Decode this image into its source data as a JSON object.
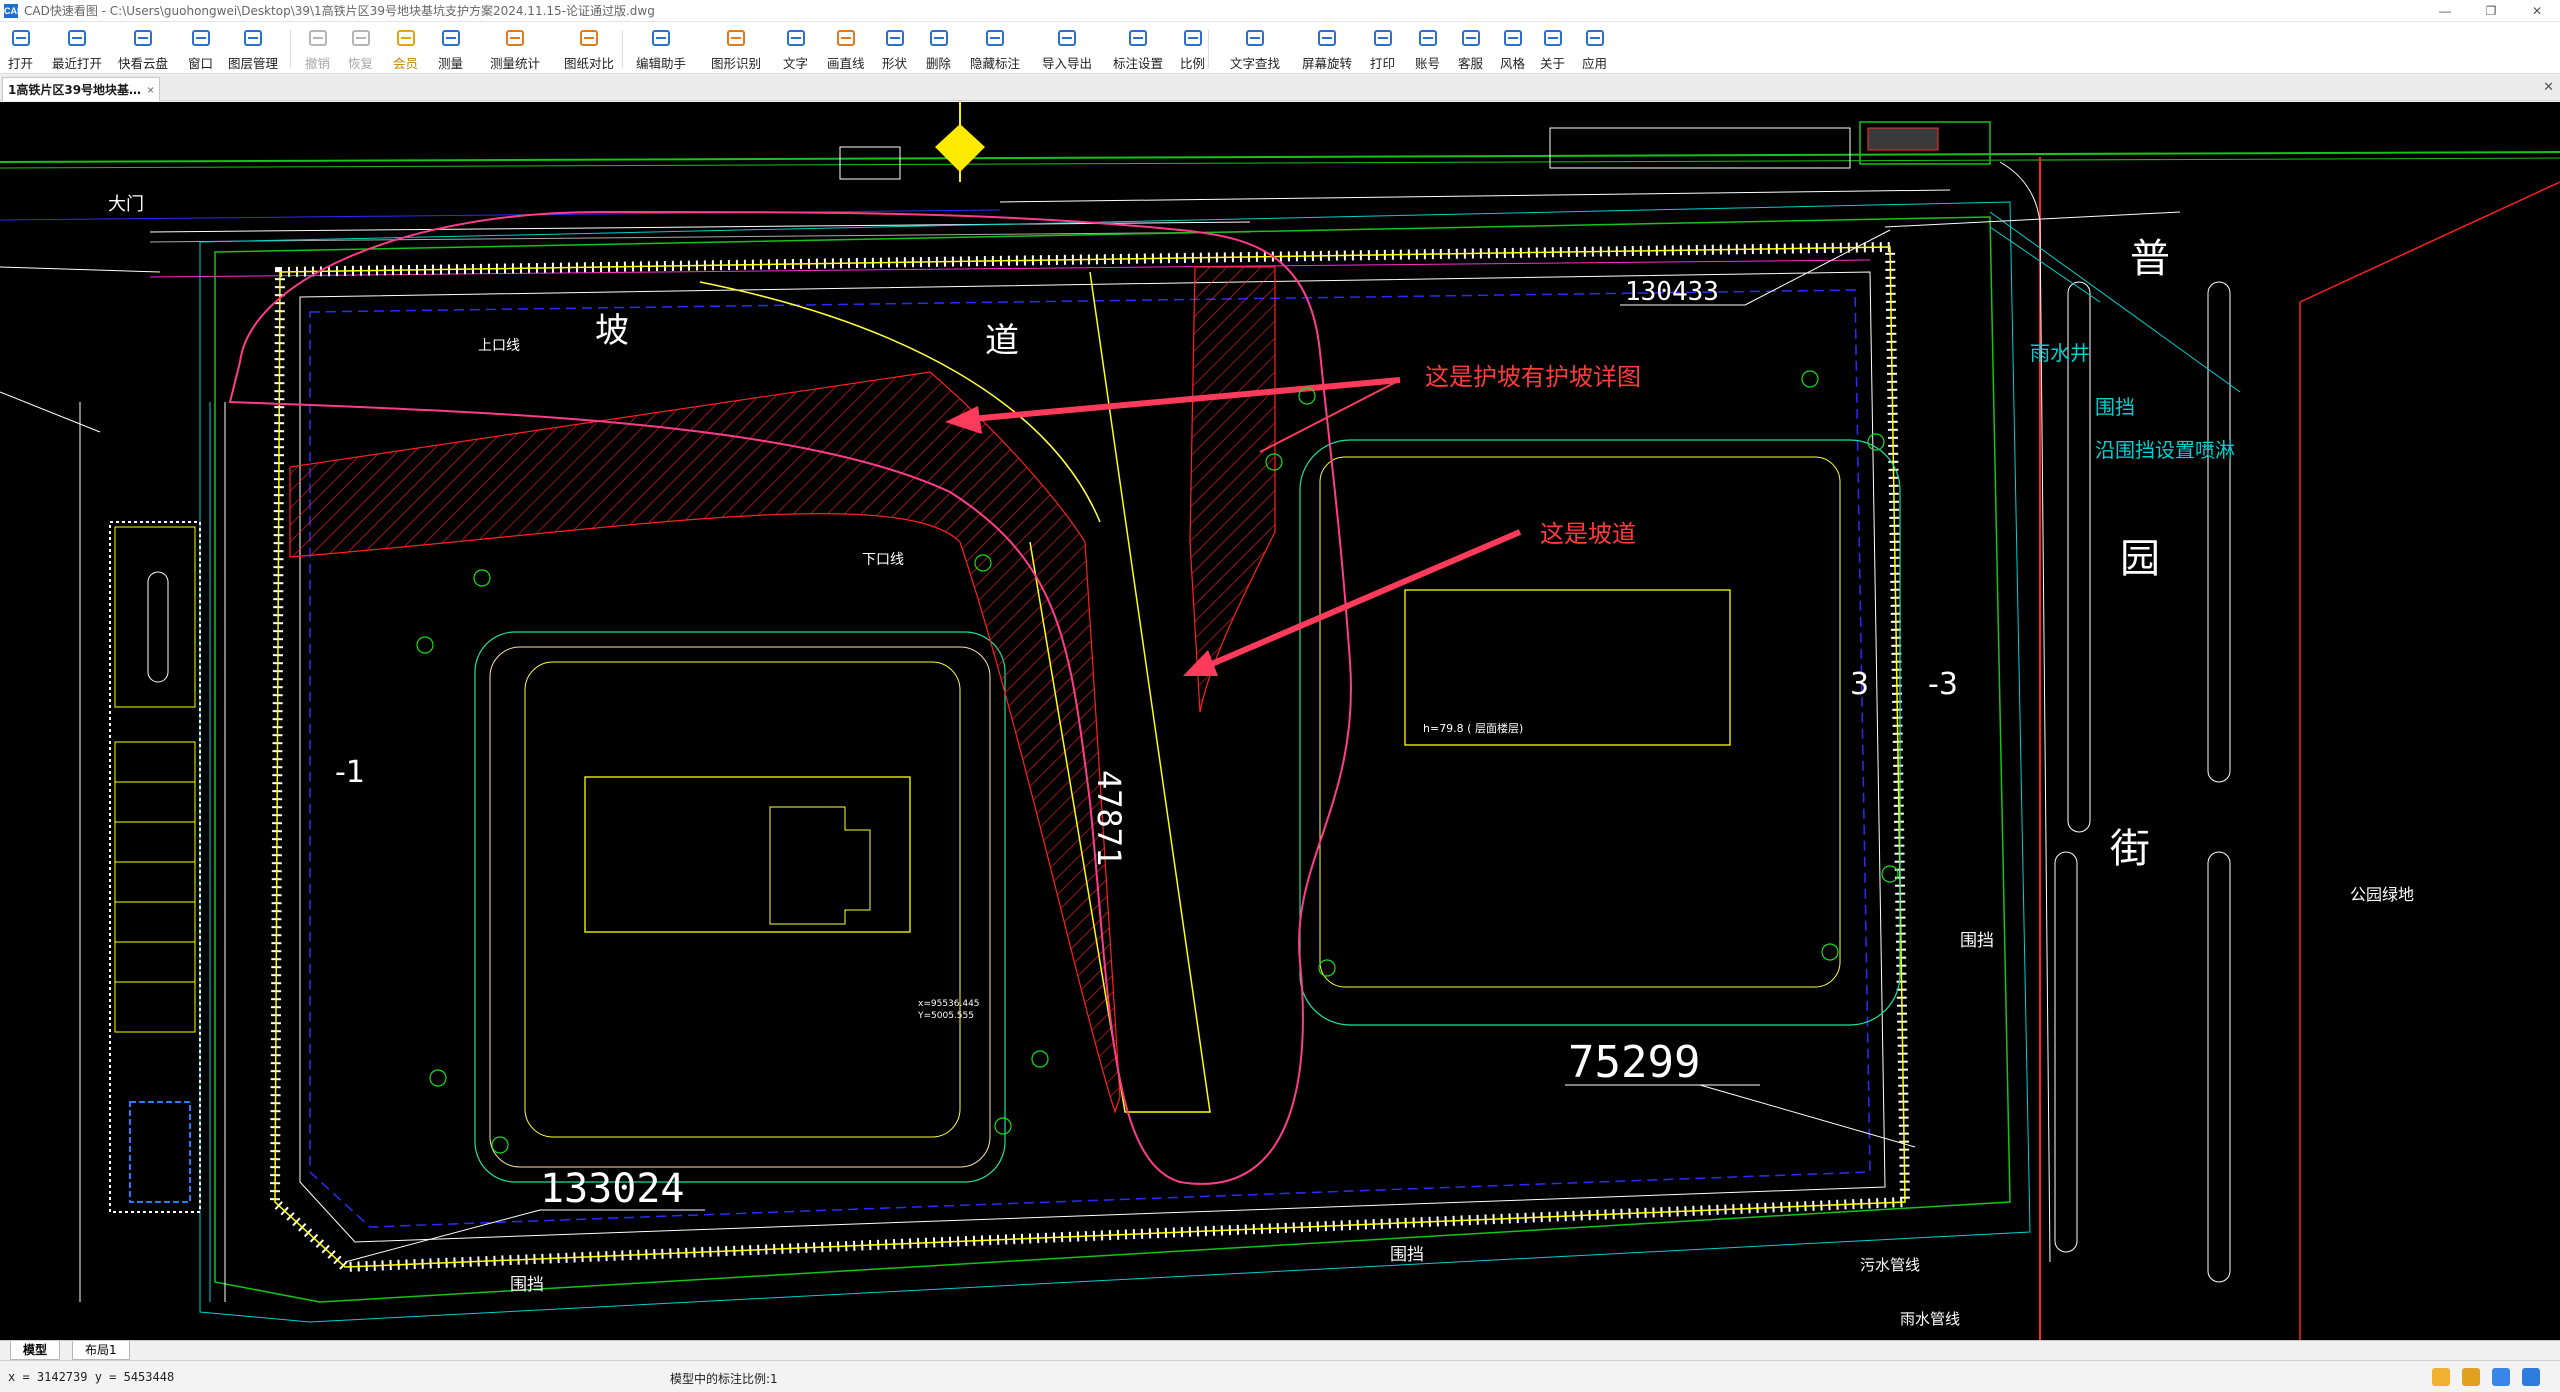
{
  "window": {
    "title": "CAD快速看图 - C:\\Users\\guohongwei\\Desktop\\39\\1高铁片区39号地块基坑支护方案2024.11.15-论证通过版.dwg",
    "app_icon": "CAD"
  },
  "toolbar": {
    "buttons": [
      {
        "label": "打开",
        "icon": "folder-open-icon",
        "color": "#2b6fcf"
      },
      {
        "label": "最近打开",
        "icon": "clock-icon",
        "color": "#2b6fcf"
      },
      {
        "label": "快看云盘",
        "icon": "cloud-icon",
        "color": "#2b6fcf"
      },
      {
        "label": "窗口",
        "icon": "window-icon",
        "color": "#2b6fcf"
      },
      {
        "label": "图层管理",
        "icon": "layers-icon",
        "color": "#2b6fcf"
      },
      {
        "label": "撤销",
        "icon": "undo-icon",
        "color": "#b5b5b5",
        "disabled": true
      },
      {
        "label": "恢复",
        "icon": "redo-icon",
        "color": "#b5b5b5",
        "disabled": true
      },
      {
        "label": "会员",
        "icon": "vip-icon",
        "color": "#e8a400",
        "vip": true
      },
      {
        "label": "测量",
        "icon": "measure-icon",
        "color": "#2b6fcf"
      },
      {
        "label": "测量统计",
        "icon": "measure-stats-icon",
        "color": "#e07a1f"
      },
      {
        "label": "图纸对比",
        "icon": "compare-icon",
        "color": "#e07a1f"
      },
      {
        "label": "编辑助手",
        "icon": "edit-assistant-icon",
        "color": "#2b6fcf"
      },
      {
        "label": "图形识别",
        "icon": "shape-recognize-icon",
        "color": "#e07a1f"
      },
      {
        "label": "文字",
        "icon": "text-icon",
        "color": "#2b6fcf"
      },
      {
        "label": "画直线",
        "icon": "line-icon",
        "color": "#e07a1f"
      },
      {
        "label": "形状",
        "icon": "shape-icon",
        "color": "#2b6fcf"
      },
      {
        "label": "删除",
        "icon": "eraser-icon",
        "color": "#2b6fcf"
      },
      {
        "label": "隐藏标注",
        "icon": "eye-hide-icon",
        "color": "#2b6fcf"
      },
      {
        "label": "导入导出",
        "icon": "import-export-icon",
        "color": "#2b6fcf"
      },
      {
        "label": "标注设置",
        "icon": "annotation-settings-icon",
        "color": "#2b6fcf"
      },
      {
        "label": "比例",
        "icon": "scale-icon",
        "color": "#2b6fcf"
      },
      {
        "label": "文字查找",
        "icon": "text-search-icon",
        "color": "#2b6fcf"
      },
      {
        "label": "屏幕旋转",
        "icon": "rotate-screen-icon",
        "color": "#2b6fcf"
      },
      {
        "label": "打印",
        "icon": "printer-icon",
        "color": "#2b6fcf"
      },
      {
        "label": "账号",
        "icon": "user-icon",
        "color": "#2b6fcf"
      },
      {
        "label": "客服",
        "icon": "headset-icon",
        "color": "#2b6fcf"
      },
      {
        "label": "风格",
        "icon": "style-icon",
        "color": "#2b6fcf"
      },
      {
        "label": "关于",
        "icon": "info-icon",
        "color": "#2b6fcf"
      },
      {
        "label": "应用",
        "icon": "apps-icon",
        "color": "#2b6fcf"
      }
    ]
  },
  "doc_tab": {
    "label": "1高铁片区39号地块基…",
    "close": "×"
  },
  "drawing": {
    "annotations": [
      {
        "text": "这是护坡有护坡详图",
        "color": "#ff3b3b"
      },
      {
        "text": "这是坡道",
        "color": "#ff3b3b"
      }
    ],
    "dimensions": [
      "130433",
      "75299",
      "133024",
      "47871"
    ],
    "street_labels": [
      "普",
      "园",
      "街"
    ],
    "labels": {
      "ramp1": "坡",
      "ramp2": "道",
      "upper": "上口线",
      "lower": "下口线",
      "rain_well": "雨水井",
      "fence": "围挡",
      "fence_spray": "沿围挡设置喷淋",
      "park": "公园绿地",
      "sewage": "污水管线",
      "rain_pipe": "雨水管线",
      "gate": "大门",
      "minus1": "-1",
      "three": "3",
      "minus3": "-3",
      "height": "h=79.8 (  层面楼层)",
      "coord_x": "x=95536.445",
      "coord_y": "Y=5005.555"
    }
  },
  "layout_tabs": [
    {
      "label": "模型",
      "active": true
    },
    {
      "label": "布局1",
      "active": false
    }
  ],
  "status": {
    "coords": "x = 3142739  y = 5453448",
    "scale": "模型中的标注比例:1"
  }
}
